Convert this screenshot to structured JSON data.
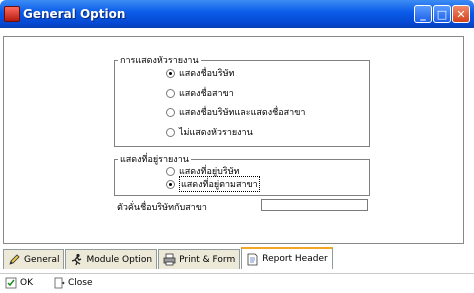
{
  "window": {
    "title": "General Option",
    "controls": {
      "minimize": "_",
      "maximize": "□",
      "close": "✕"
    }
  },
  "report_header_group": {
    "legend": "การแสดงหัวรายงาน",
    "options": [
      {
        "label": "แสดงชื่อบริษัท",
        "checked": true
      },
      {
        "label": "แสดงชื่อสาขา",
        "checked": false
      },
      {
        "label": "แสดงชื่อบริษัทและแสดงชื่อสาขา",
        "checked": false
      },
      {
        "label": "ไม่แสดงหัวรายงาน",
        "checked": false
      }
    ]
  },
  "reporter_group": {
    "legend": "แสดงที่อยู่รายงาน",
    "options": [
      {
        "label": "แสดงที่อยู่บริษัท",
        "checked": false
      },
      {
        "label": "แสดงที่อยู่ตามสาขา",
        "checked": true
      }
    ]
  },
  "separator_field": {
    "label": "ตัวคั่นชื่อบริษัทกับสาขา",
    "value": ""
  },
  "tabs": [
    {
      "label": "General",
      "icon": "pencil-icon",
      "active": false
    },
    {
      "label": "Module Option",
      "icon": "runner-icon",
      "active": false
    },
    {
      "label": "Print & Form",
      "icon": "printer-icon",
      "active": false
    },
    {
      "label": "Report Header",
      "icon": "document-icon",
      "active": true
    }
  ],
  "buttons": {
    "ok_label": "OK",
    "close_label": "Close"
  }
}
